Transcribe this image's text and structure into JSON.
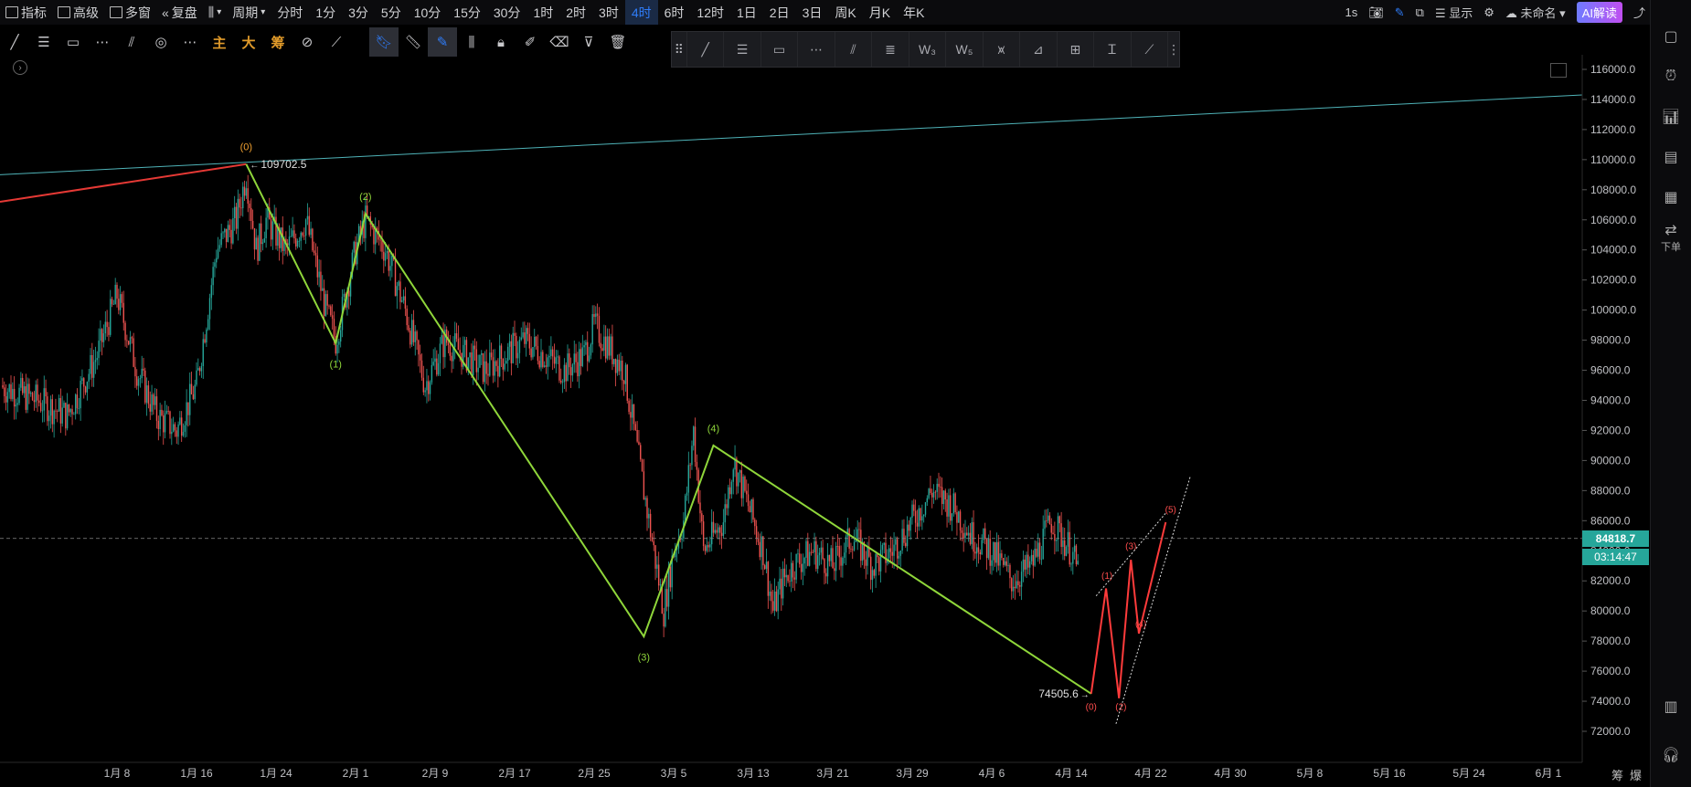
{
  "toolbar": {
    "indicators": "指标",
    "advanced": "高级",
    "multi_window": "多窗",
    "replay": "复盘",
    "period": "周期",
    "timeframes": [
      "分时",
      "1分",
      "3分",
      "5分",
      "10分",
      "15分",
      "30分",
      "1时",
      "2时",
      "3时",
      "4时",
      "6时",
      "12时",
      "1日",
      "2日",
      "3日",
      "周K",
      "月K",
      "年K"
    ],
    "active_timeframe": "4时",
    "refresh": "1s",
    "display": "显示",
    "layout_name": "未命名",
    "ai_button": "AI解读"
  },
  "drawing_tools": {
    "zhu": "主",
    "da": "大",
    "chou": "筹"
  },
  "right_panel": {
    "order": "下单",
    "bottom_left": "筹",
    "bottom_right": "爆"
  },
  "chart_data": {
    "type": "candlestick",
    "y_ticks": [
      116000.0,
      114000.0,
      112000.0,
      110000.0,
      108000.0,
      106000.0,
      104000.0,
      102000.0,
      100000.0,
      98000.0,
      96000.0,
      94000.0,
      92000.0,
      90000.0,
      88000.0,
      86000.0,
      84000.0,
      82000.0,
      80000.0,
      78000.0,
      76000.0,
      74000.0,
      72000.0
    ],
    "x_ticks": [
      "1月 8",
      "1月 16",
      "1月 24",
      "2月 1",
      "2月 9",
      "2月 17",
      "2月 25",
      "3月 5",
      "3月 13",
      "3月 21",
      "3月 29",
      "4月 6",
      "4月 14",
      "4月 22",
      "4月 30",
      "5月 8",
      "5月 16",
      "5月 24",
      "6月 1"
    ],
    "last_price": "84818.7",
    "countdown": "03:14:47",
    "high_label": "109702.5",
    "low_label": "74505.6",
    "green_wave_labels": [
      "(0)",
      "(1)",
      "(2)",
      "(3)",
      "(4)"
    ],
    "red_wave_labels": [
      "(0)",
      "(1)",
      "(2)",
      "(3)",
      "(4)",
      "(5)"
    ],
    "colors": {
      "up": "#26a69a",
      "down": "#ef5350",
      "wave": "#8fd63a",
      "red_line": "#e53935",
      "trend": "#4fb3b8"
    }
  }
}
